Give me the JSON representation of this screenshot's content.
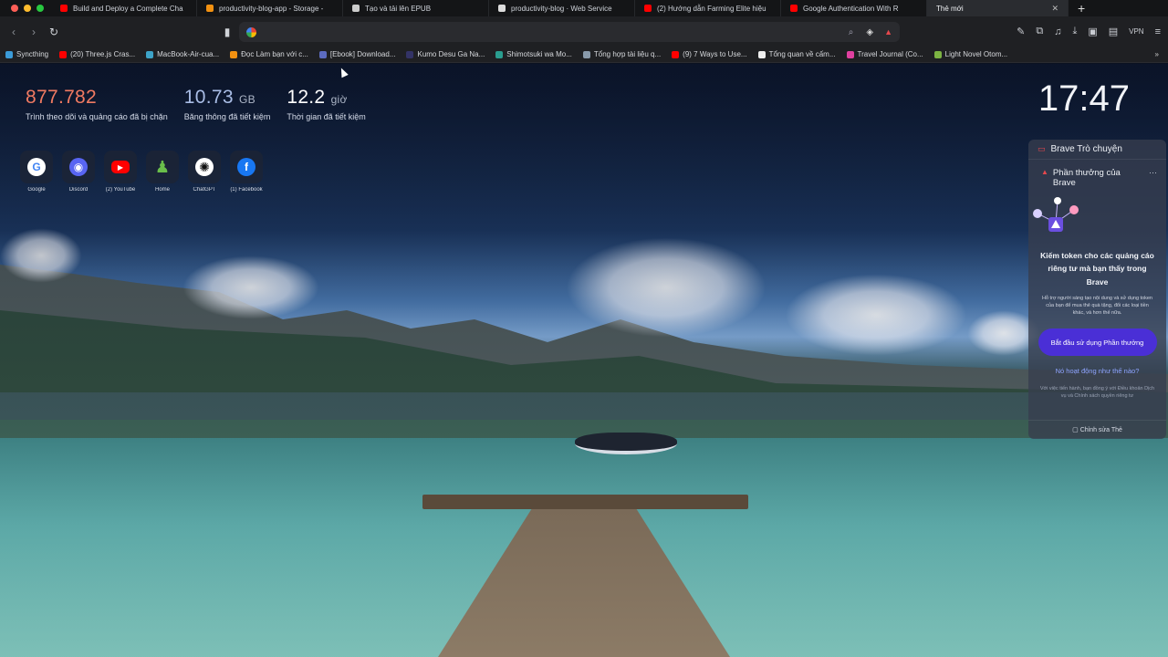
{
  "window": {
    "traffic_lights": [
      "#ff5f57",
      "#febc2e",
      "#28c840"
    ]
  },
  "tabs": [
    {
      "label": "Build and Deploy a Complete Cha",
      "favicon_color": "#ff0000",
      "active": false
    },
    {
      "label": "productivity-blog-app - Storage -",
      "favicon_color": "#f29111",
      "active": false
    },
    {
      "label": "Tạo và tải lên EPUB",
      "favicon_color": "#cccccc",
      "active": false
    },
    {
      "label": "productivity-blog · Web Service",
      "favicon_color": "#dddddd",
      "active": false
    },
    {
      "label": "(2) Hướng dẫn Farming Elite hiệu",
      "favicon_color": "#ff0000",
      "active": false
    },
    {
      "label": "Google Authentication With R",
      "favicon_color": "#ff0000",
      "active": false
    },
    {
      "label": "Thẻ mới",
      "favicon_color": "",
      "active": true
    }
  ],
  "toolbar": {
    "url_value": "",
    "vpn_label": "VPN"
  },
  "bookmarks": [
    {
      "label": "Syncthing",
      "color": "#3b9bd8"
    },
    {
      "label": "(20) Three.js Cras...",
      "color": "#ff0000"
    },
    {
      "label": "MacBook-Air-cua...",
      "color": "#3da3c8"
    },
    {
      "label": "Đọc Làm bạn với c...",
      "color": "#f29111"
    },
    {
      "label": "[Ebook] Download...",
      "color": "#5c6bc0"
    },
    {
      "label": "Kumo Desu Ga Na...",
      "color": "#333366"
    },
    {
      "label": "Shimotsuki wa Mo...",
      "color": "#2a9d8f"
    },
    {
      "label": "Tổng hợp tài liệu q...",
      "color": "#8899aa"
    },
    {
      "label": "(9) 7 Ways to Use...",
      "color": "#ff0000"
    },
    {
      "label": "Tổng quan về cấm...",
      "color": "#eeeeee"
    },
    {
      "label": "Travel Journal (Co...",
      "color": "#e040a0"
    },
    {
      "label": "Light Novel Otom...",
      "color": "#7cb342"
    }
  ],
  "stats": {
    "trackers_value": "877.782",
    "trackers_label": "Trình theo dõi và quảng cáo đã bị chặn",
    "bandwidth_value": "10.73",
    "bandwidth_unit": "GB",
    "bandwidth_label": "Băng thông đã tiết kiệm",
    "time_value": "12.2",
    "time_unit": "giờ",
    "time_label": "Thời gian đã tiết kiệm"
  },
  "clock": "17:47",
  "top_sites": [
    {
      "name": "Google",
      "icon": "google-icon"
    },
    {
      "name": "Discord",
      "icon": "discord-icon"
    },
    {
      "name": "(2) YouTube",
      "icon": "youtube-icon"
    },
    {
      "name": "Home",
      "icon": "chess-pawn-icon"
    },
    {
      "name": "ChatGPT",
      "icon": "chatgpt-icon"
    },
    {
      "name": "(1) Facebook",
      "icon": "facebook-icon"
    }
  ],
  "panel": {
    "chat_title": "Brave Trò chuyện",
    "rewards_title": "Phần thưởng của Brave",
    "headline": "Kiếm token cho các quảng cáo riêng tư mà bạn thấy trong Brave",
    "description": "Hỗ trợ người sáng tạo nội dung và sử dụng token của bạn để mua thẻ quà tặng, đổi các loại tiền khác, và hơn thế nữa.",
    "cta": "Bắt đầu sử dụng Phần thưởng",
    "how_link": "Nó hoạt động như thế nào?",
    "fine_print": "Với việc tiến hành, bạn đồng ý với Điều khoản Dịch vụ và Chính sách quyền riêng tư",
    "footer": "Chỉnh sửa Thẻ"
  }
}
